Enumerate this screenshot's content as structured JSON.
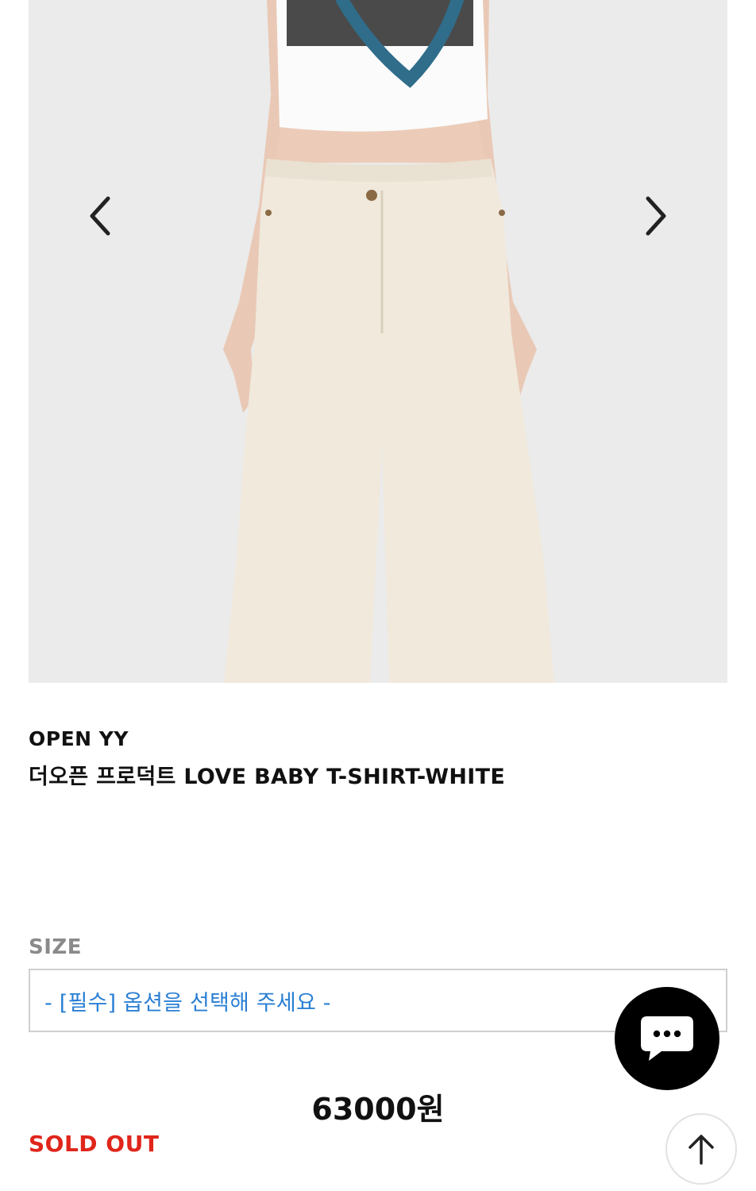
{
  "gallery": {
    "image_alt": "product-photo",
    "prev_icon": "chevron-left-icon",
    "next_icon": "chevron-right-icon"
  },
  "product": {
    "brand": "OPEN YY",
    "name": "더오픈 프로덕트 LOVE BABY T-SHIRT-WHITE",
    "price": "63000원",
    "status": "SOLD OUT"
  },
  "option": {
    "label": "SIZE",
    "placeholder": "- [필수] 옵션을 선택해 주세요 -"
  },
  "widgets": {
    "chat_icon": "chat-bubble-icon",
    "scroll_top_icon": "arrow-up-icon"
  },
  "colors": {
    "accent_blue": "#2a7fd4",
    "sold_out_red": "#e0251b",
    "label_gray": "#8a8a8a"
  }
}
